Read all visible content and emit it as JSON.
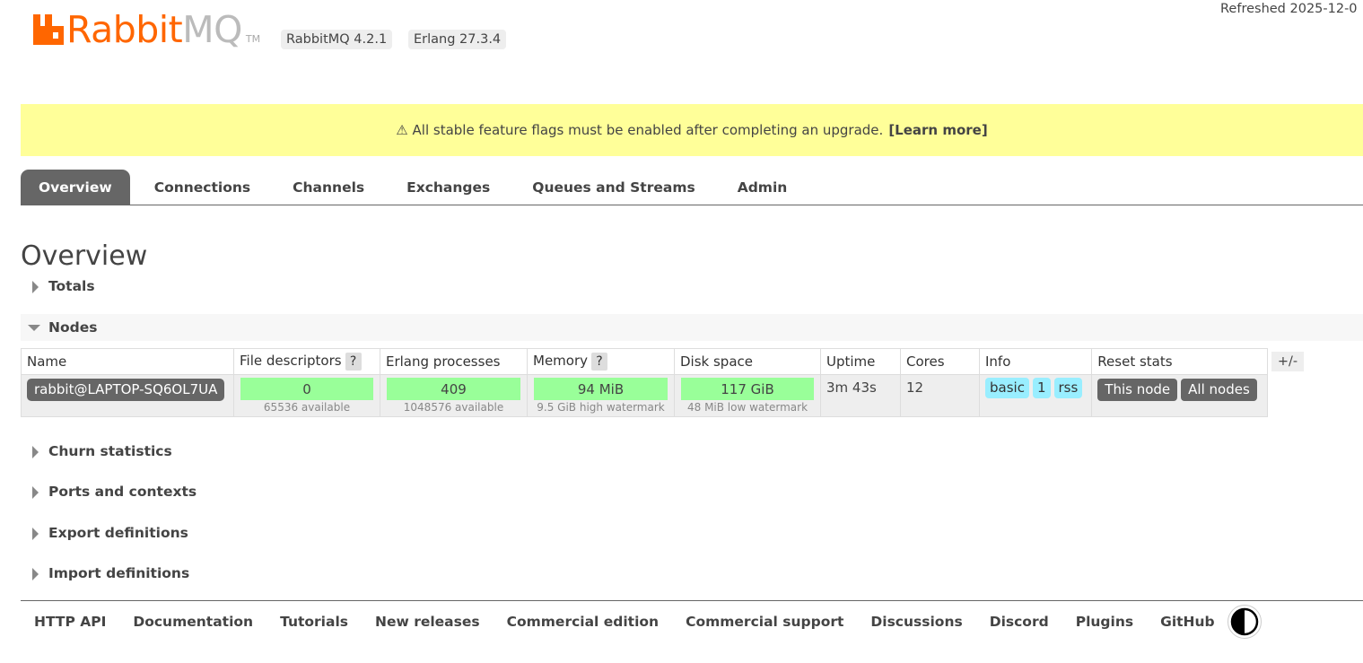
{
  "header": {
    "logo_text_rabbit": "Rabbit",
    "logo_text_mq": "MQ",
    "logo_tm": "TM",
    "rabbitmq_version": "RabbitMQ 4.2.1",
    "erlang_version": "Erlang 27.3.4",
    "refreshed": "Refreshed 2025-12-0"
  },
  "banner": {
    "icon": "warning-icon",
    "text": "⚠ All stable feature flags must be enabled after completing an upgrade.",
    "link": "[Learn more]"
  },
  "tabs": [
    {
      "label": "Overview",
      "active": true
    },
    {
      "label": "Connections"
    },
    {
      "label": "Channels"
    },
    {
      "label": "Exchanges"
    },
    {
      "label": "Queues and Streams"
    },
    {
      "label": "Admin"
    }
  ],
  "page_title": "Overview",
  "sections": {
    "totals": "Totals",
    "nodes": "Nodes",
    "churn": "Churn statistics",
    "ports": "Ports and contexts",
    "export": "Export definitions",
    "import": "Import definitions"
  },
  "nodes_table": {
    "headers": {
      "name": "Name",
      "fd": "File descriptors",
      "erlang": "Erlang processes",
      "memory": "Memory",
      "disk": "Disk space",
      "uptime": "Uptime",
      "cores": "Cores",
      "info": "Info",
      "reset": "Reset stats"
    },
    "help": "?",
    "row": {
      "name": "rabbit@LAPTOP-SQ6OL7UA",
      "fd_value": "0",
      "fd_sub": "65536 available",
      "erlang_value": "409",
      "erlang_sub": "1048576 available",
      "memory_value": "94 MiB",
      "memory_sub": "9.5 GiB high watermark",
      "disk_value": "117 GiB",
      "disk_sub": "48 MiB low watermark",
      "uptime": "3m 43s",
      "cores": "12",
      "info_tags": [
        "basic",
        "1",
        "rss"
      ],
      "reset_this": "This node",
      "reset_all": "All nodes"
    },
    "plus_minus": "+/-"
  },
  "footer": {
    "links": [
      "HTTP API",
      "Documentation",
      "Tutorials",
      "New releases",
      "Commercial edition",
      "Commercial support",
      "Discussions",
      "Discord",
      "Plugins",
      "GitHub"
    ],
    "theme_icon": "theme-toggle-icon"
  },
  "colors": {
    "brand": "#ff6600",
    "banner_bg": "#ffff99",
    "bar_ok": "#99ff99",
    "tag": "#99eeff",
    "tab_active": "#666666"
  }
}
